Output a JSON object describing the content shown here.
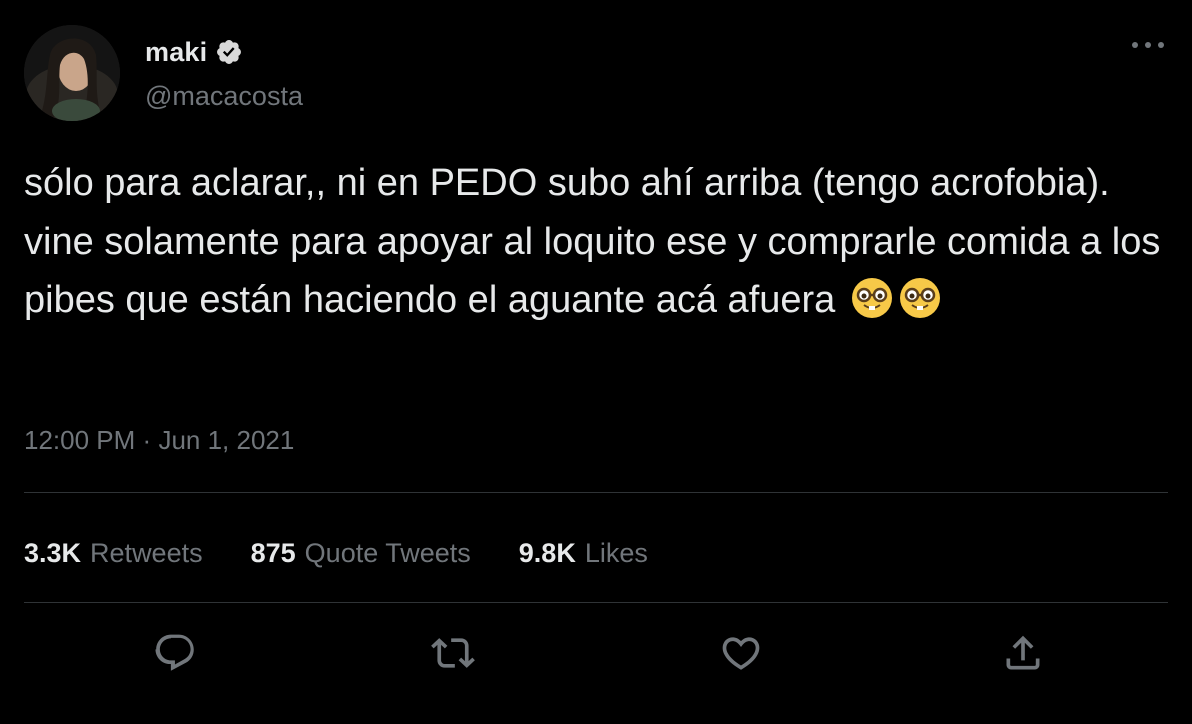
{
  "author": {
    "display_name": "maki",
    "handle": "@macacosta",
    "verified": true
  },
  "tweet": {
    "text": "sólo para aclarar,, ni en PEDO subo ahí arriba (tengo acrofobia). vine solamente para apoyar al loquito ese y comprarle comida a los pibes que están haciendo el aguante acá afuera",
    "emojis": [
      "nerd-face-emoji",
      "nerd-face-emoji"
    ],
    "time": "12:00 PM",
    "separator": "·",
    "date": "Jun 1, 2021"
  },
  "stats": {
    "retweets_count": "3.3K",
    "retweets_label": "Retweets",
    "quote_tweets_count": "875",
    "quote_tweets_label": "Quote Tweets",
    "likes_count": "9.8K",
    "likes_label": "Likes"
  },
  "actions": [
    "reply-icon",
    "retweet-icon",
    "like-icon",
    "share-icon"
  ],
  "colors": {
    "background": "#000000",
    "primary_text": "#e7e9ea",
    "secondary_text": "#71767b",
    "divider": "#2f3336",
    "emoji_face": "#f7c948"
  }
}
